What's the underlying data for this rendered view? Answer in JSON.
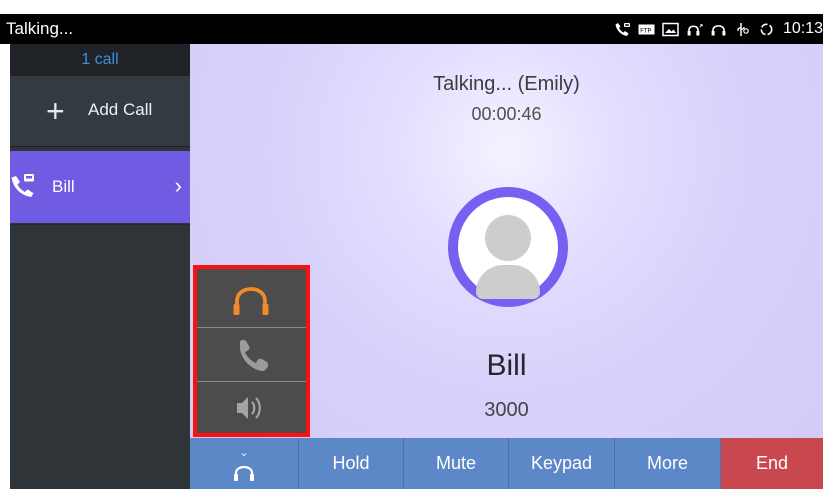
{
  "status_bar": {
    "title": "Talking...",
    "time": "10:13",
    "icons": [
      "phone-icon",
      "ftp-icon",
      "image-icon",
      "bluetooth-headset-icon",
      "headset-icon",
      "usb-icon",
      "sync-icon"
    ]
  },
  "sidebar": {
    "call_count": "1 call",
    "add_call_label": "Add Call",
    "active_call": {
      "name": "Bill"
    }
  },
  "call": {
    "status_text": "Talking... (Emily)",
    "duration": "00:00:46",
    "contact_name": "Bill",
    "contact_number": "3000"
  },
  "audio_options": [
    {
      "icon": "headset-icon",
      "selected": true
    },
    {
      "icon": "handset-icon",
      "selected": false
    },
    {
      "icon": "speaker-icon",
      "selected": false
    }
  ],
  "toolbar": {
    "audio_label": "",
    "hold_label": "Hold",
    "mute_label": "Mute",
    "keypad_label": "Keypad",
    "more_label": "More",
    "end_label": "End"
  },
  "colors": {
    "accent": "#6f5ce3",
    "status_active": "#3f8fd8",
    "end_call": "#c9474f",
    "toolbar": "#5c88c7",
    "audio_selected": "#f28a2a"
  }
}
